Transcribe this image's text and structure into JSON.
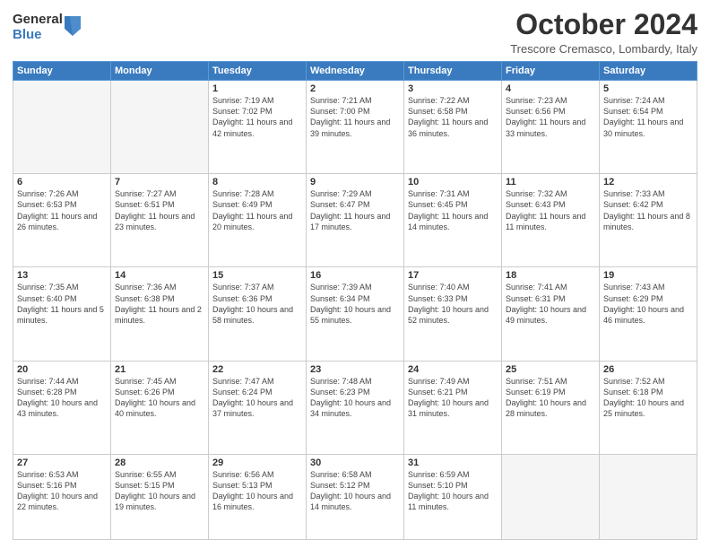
{
  "logo": {
    "general": "General",
    "blue": "Blue"
  },
  "title": "October 2024",
  "subtitle": "Trescore Cremasco, Lombardy, Italy",
  "days_header": [
    "Sunday",
    "Monday",
    "Tuesday",
    "Wednesday",
    "Thursday",
    "Friday",
    "Saturday"
  ],
  "weeks": [
    [
      {
        "day": "",
        "text": ""
      },
      {
        "day": "",
        "text": ""
      },
      {
        "day": "1",
        "text": "Sunrise: 7:19 AM\nSunset: 7:02 PM\nDaylight: 11 hours and 42 minutes."
      },
      {
        "day": "2",
        "text": "Sunrise: 7:21 AM\nSunset: 7:00 PM\nDaylight: 11 hours and 39 minutes."
      },
      {
        "day": "3",
        "text": "Sunrise: 7:22 AM\nSunset: 6:58 PM\nDaylight: 11 hours and 36 minutes."
      },
      {
        "day": "4",
        "text": "Sunrise: 7:23 AM\nSunset: 6:56 PM\nDaylight: 11 hours and 33 minutes."
      },
      {
        "day": "5",
        "text": "Sunrise: 7:24 AM\nSunset: 6:54 PM\nDaylight: 11 hours and 30 minutes."
      }
    ],
    [
      {
        "day": "6",
        "text": "Sunrise: 7:26 AM\nSunset: 6:53 PM\nDaylight: 11 hours and 26 minutes."
      },
      {
        "day": "7",
        "text": "Sunrise: 7:27 AM\nSunset: 6:51 PM\nDaylight: 11 hours and 23 minutes."
      },
      {
        "day": "8",
        "text": "Sunrise: 7:28 AM\nSunset: 6:49 PM\nDaylight: 11 hours and 20 minutes."
      },
      {
        "day": "9",
        "text": "Sunrise: 7:29 AM\nSunset: 6:47 PM\nDaylight: 11 hours and 17 minutes."
      },
      {
        "day": "10",
        "text": "Sunrise: 7:31 AM\nSunset: 6:45 PM\nDaylight: 11 hours and 14 minutes."
      },
      {
        "day": "11",
        "text": "Sunrise: 7:32 AM\nSunset: 6:43 PM\nDaylight: 11 hours and 11 minutes."
      },
      {
        "day": "12",
        "text": "Sunrise: 7:33 AM\nSunset: 6:42 PM\nDaylight: 11 hours and 8 minutes."
      }
    ],
    [
      {
        "day": "13",
        "text": "Sunrise: 7:35 AM\nSunset: 6:40 PM\nDaylight: 11 hours and 5 minutes."
      },
      {
        "day": "14",
        "text": "Sunrise: 7:36 AM\nSunset: 6:38 PM\nDaylight: 11 hours and 2 minutes."
      },
      {
        "day": "15",
        "text": "Sunrise: 7:37 AM\nSunset: 6:36 PM\nDaylight: 10 hours and 58 minutes."
      },
      {
        "day": "16",
        "text": "Sunrise: 7:39 AM\nSunset: 6:34 PM\nDaylight: 10 hours and 55 minutes."
      },
      {
        "day": "17",
        "text": "Sunrise: 7:40 AM\nSunset: 6:33 PM\nDaylight: 10 hours and 52 minutes."
      },
      {
        "day": "18",
        "text": "Sunrise: 7:41 AM\nSunset: 6:31 PM\nDaylight: 10 hours and 49 minutes."
      },
      {
        "day": "19",
        "text": "Sunrise: 7:43 AM\nSunset: 6:29 PM\nDaylight: 10 hours and 46 minutes."
      }
    ],
    [
      {
        "day": "20",
        "text": "Sunrise: 7:44 AM\nSunset: 6:28 PM\nDaylight: 10 hours and 43 minutes."
      },
      {
        "day": "21",
        "text": "Sunrise: 7:45 AM\nSunset: 6:26 PM\nDaylight: 10 hours and 40 minutes."
      },
      {
        "day": "22",
        "text": "Sunrise: 7:47 AM\nSunset: 6:24 PM\nDaylight: 10 hours and 37 minutes."
      },
      {
        "day": "23",
        "text": "Sunrise: 7:48 AM\nSunset: 6:23 PM\nDaylight: 10 hours and 34 minutes."
      },
      {
        "day": "24",
        "text": "Sunrise: 7:49 AM\nSunset: 6:21 PM\nDaylight: 10 hours and 31 minutes."
      },
      {
        "day": "25",
        "text": "Sunrise: 7:51 AM\nSunset: 6:19 PM\nDaylight: 10 hours and 28 minutes."
      },
      {
        "day": "26",
        "text": "Sunrise: 7:52 AM\nSunset: 6:18 PM\nDaylight: 10 hours and 25 minutes."
      }
    ],
    [
      {
        "day": "27",
        "text": "Sunrise: 6:53 AM\nSunset: 5:16 PM\nDaylight: 10 hours and 22 minutes."
      },
      {
        "day": "28",
        "text": "Sunrise: 6:55 AM\nSunset: 5:15 PM\nDaylight: 10 hours and 19 minutes."
      },
      {
        "day": "29",
        "text": "Sunrise: 6:56 AM\nSunset: 5:13 PM\nDaylight: 10 hours and 16 minutes."
      },
      {
        "day": "30",
        "text": "Sunrise: 6:58 AM\nSunset: 5:12 PM\nDaylight: 10 hours and 14 minutes."
      },
      {
        "day": "31",
        "text": "Sunrise: 6:59 AM\nSunset: 5:10 PM\nDaylight: 10 hours and 11 minutes."
      },
      {
        "day": "",
        "text": ""
      },
      {
        "day": "",
        "text": ""
      }
    ]
  ]
}
